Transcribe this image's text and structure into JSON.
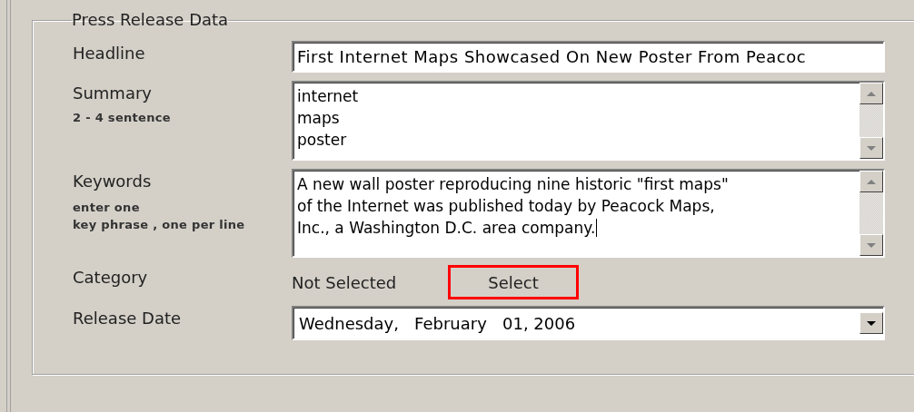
{
  "group": {
    "title": "Press Release Data"
  },
  "fields": [
    {
      "kind": "text",
      "label": "Headline",
      "value": "First Internet Maps Showcased On New Poster From Peacoc"
    },
    {
      "kind": "textarea",
      "label": "Summary",
      "hint_lines": [
        "2 - 4 sentence"
      ],
      "lines": [
        "internet",
        "maps",
        "poster"
      ],
      "caret": false
    },
    {
      "kind": "textarea",
      "label": "Keywords",
      "hint_lines": [
        "enter one",
        "key phrase , one per line"
      ],
      "lines": [
        "A new wall poster reproducing nine historic \"first maps\"",
        "of the Internet was published today by Peacock Maps,",
        "Inc., a Washington D.C. area company."
      ],
      "caret": true
    },
    {
      "kind": "picker",
      "label": "Category",
      "value": "Not Selected",
      "button": {
        "label": "Select",
        "highlighted": true
      }
    },
    {
      "kind": "dropdown",
      "label": "Release Date",
      "value": "Wednesday,   February   01, 2006"
    }
  ]
}
